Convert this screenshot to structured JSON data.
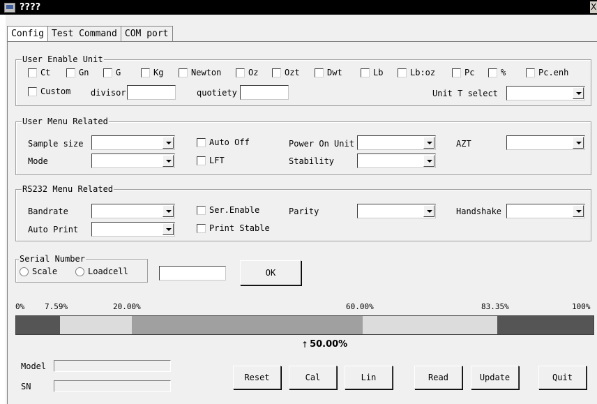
{
  "window": {
    "title": "????",
    "close_glyph": "X"
  },
  "tabs": [
    {
      "label": "Config"
    },
    {
      "label": "Test Command"
    },
    {
      "label": "COM port"
    }
  ],
  "user_enable_unit": {
    "title": "User Enable Unit",
    "units": [
      "Ct",
      "Gn",
      "G",
      "Kg",
      "Newton",
      "Oz",
      "Ozt",
      "Dwt",
      "Lb",
      "Lb:oz",
      "Pc",
      "%",
      "Pc.enh"
    ],
    "custom_label": "Custom",
    "divisor_label": "divisor",
    "divisor_value": "",
    "quotiety_label": "quotiety",
    "quotiety_value": "",
    "unit_t_select_label": "Unit T select",
    "unit_t_select_value": ""
  },
  "user_menu": {
    "title": "User Menu Related",
    "sample_size_label": "Sample size",
    "mode_label": "Mode",
    "auto_off_label": "Auto Off",
    "lft_label": "LFT",
    "power_on_unit_label": "Power On Unit",
    "stability_label": "Stability",
    "azt_label": "AZT"
  },
  "rs232": {
    "title": "RS232 Menu Related",
    "bandrate_label": "Bandrate",
    "auto_print_label": "Auto Print",
    "ser_enable_label": "Ser.Enable",
    "print_stable_label": "Print Stable",
    "parity_label": "Parity",
    "handshake_label": "Handshake"
  },
  "serial": {
    "title": "Serial Number",
    "scale_label": "Scale",
    "loadcell_label": "Loadcell",
    "value": "",
    "ok_label": "OK"
  },
  "progress": {
    "ticks": [
      "0%",
      "7.59%",
      "20.00%",
      "60.00%",
      "83.35%",
      "100%"
    ],
    "segments": [
      {
        "from": 0,
        "to": 7.59,
        "color": "#555555"
      },
      {
        "from": 7.59,
        "to": 20.0,
        "color": "#dcdcdc"
      },
      {
        "from": 20.0,
        "to": 60.0,
        "color": "#a0a0a0"
      },
      {
        "from": 60.0,
        "to": 83.35,
        "color": "#dcdcdc"
      },
      {
        "from": 83.35,
        "to": 100,
        "color": "#555555"
      }
    ],
    "marker_label": "50.00%",
    "marker_value": 50.0
  },
  "footer": {
    "model_label": "Model",
    "sn_label": "SN",
    "buttons": [
      "Reset",
      "Cal",
      "Lin",
      "Read",
      "Update",
      "Quit"
    ]
  }
}
